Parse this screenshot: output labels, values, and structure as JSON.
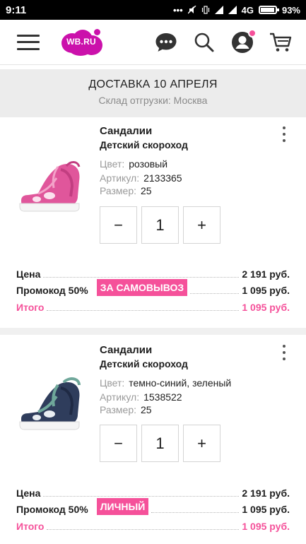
{
  "status_bar": {
    "time": "9:11",
    "network": "4G",
    "battery": "93%"
  },
  "header": {
    "logo_text": "WB.RU",
    "brand_color": "#cb11ab",
    "icons": [
      "menu-icon",
      "chat-icon",
      "search-icon",
      "profile-icon",
      "cart-icon"
    ]
  },
  "delivery": {
    "title": "ДОСТАВКА 10 АПРЕЛЯ",
    "warehouse": "Склад отгрузки: Москва"
  },
  "products": [
    {
      "title": "Сандалии",
      "brand": "Детский скороход",
      "color_label": "Цвет:",
      "color_value": "розовый",
      "sku_label": "Артикул:",
      "sku_value": "2133365",
      "size_label": "Размер:",
      "size_value": "25",
      "qty": "1",
      "minus": "−",
      "plus": "+",
      "price_label": "Цена",
      "price_value": "2 191 руб.",
      "promo_label": "Промокод 50%",
      "promo_badge": "ЗА САМОВЫВОЗ",
      "promo_value": "1 095 руб.",
      "total_label": "Итого",
      "total_value": "1 095 руб.",
      "shoe_color": "#e0569b"
    },
    {
      "title": "Сандалии",
      "brand": "Детский скороход",
      "color_label": "Цвет:",
      "color_value": "темно-синий, зеленый",
      "sku_label": "Артикул:",
      "sku_value": "1538522",
      "size_label": "Размер:",
      "size_value": "25",
      "qty": "1",
      "minus": "−",
      "plus": "+",
      "price_label": "Цена",
      "price_value": "2 191 руб.",
      "promo_label": "Промокод 50%",
      "promo_badge": "ЛИЧНЫЙ",
      "promo_value": "1 095 руб.",
      "total_label": "Итого",
      "total_value": "1 095 руб.",
      "shoe_color": "#2f3d5c"
    }
  ],
  "accent_color": "#f5519a"
}
